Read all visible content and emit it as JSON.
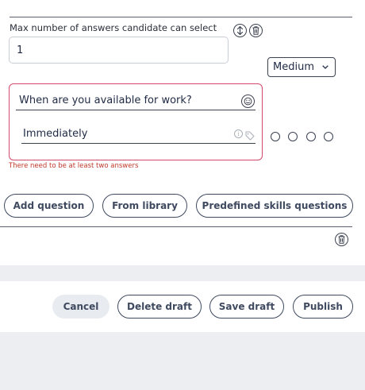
{
  "question_settings": {
    "max_answers_label": "Max number of answers candidate can select",
    "max_answers_value": "1",
    "difficulty_selected": "Medium"
  },
  "question": {
    "text": "When are you available for work?",
    "answer_text": "Immediately",
    "info_glyph": "i",
    "error_text": "There need to be at least two answers"
  },
  "add_actions": {
    "add_question": "Add question",
    "from_library": "From library",
    "predefined": "Predefined skills questions"
  },
  "footer": {
    "cancel": "Cancel",
    "delete_draft": "Delete draft",
    "save_draft": "Save draft",
    "publish": "Publish"
  },
  "icons": {
    "reorder": "sort-vertical-icon",
    "delete": "trash-icon",
    "emoji": "emoji-icon",
    "info": "info-icon",
    "tag": "tag-icon",
    "dropdown": "chevron-down-icon"
  },
  "colors": {
    "error_border": "#d44a6a",
    "error_text": "#c0392b",
    "button_text": "#3f4a60",
    "gray_band": "#eceef1"
  }
}
